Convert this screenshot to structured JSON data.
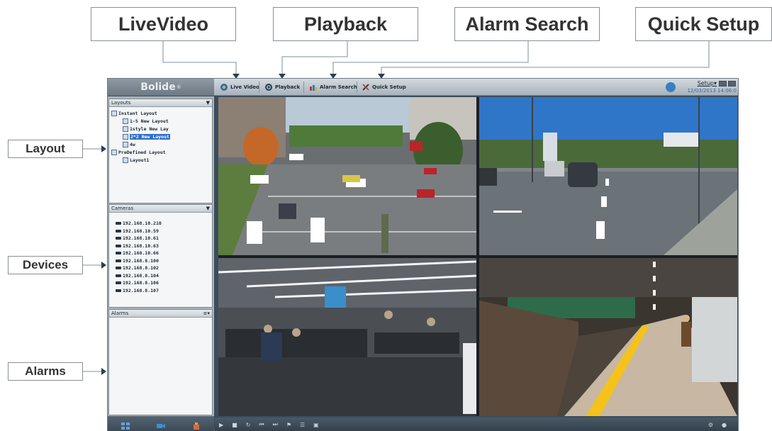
{
  "callouts": {
    "live_video": "LiveVideo",
    "playback": "Playback",
    "alarm_search": "Alarm Search",
    "quick_setup": "Quick Setup",
    "layout": "Layout",
    "devices": "Devices",
    "alarms": "Alarms"
  },
  "app": {
    "brand": "Bolide",
    "brand_mark": "®",
    "nav": [
      "Live Video",
      "Playback",
      "Alarm Search",
      "Quick Setup"
    ],
    "setup": "Setup▾",
    "datetime": "12/03/2013 14:06:0"
  },
  "layouts_panel": {
    "title": "Layouts",
    "items": [
      {
        "label": "Instant Layout",
        "level": 0
      },
      {
        "label": "1-5 New Layout",
        "level": 1
      },
      {
        "label": "1style New Lay",
        "level": 1
      },
      {
        "label": "2*2 New Layout",
        "level": 1,
        "selected": true
      },
      {
        "label": "4w",
        "level": 1
      },
      {
        "label": "PreDefined Layout",
        "level": 0
      },
      {
        "label": "Layout1",
        "level": 1
      }
    ]
  },
  "cameras_panel": {
    "title": "Cameras",
    "items": [
      "192.168.10.210",
      "192.168.10.59",
      "192.168.10.61",
      "192.168.10.63",
      "192.168.10.66",
      "192.168.8.100",
      "192.168.8.102",
      "192.168.8.104",
      "192.168.8.106",
      "192.168.8.107"
    ]
  },
  "alarms_panel": {
    "title": "Alarms"
  },
  "colors": {
    "accent": "#2f6fc9",
    "window_bg": "#3b4d5c",
    "callout_border": "#8a8f96"
  },
  "icons": [
    "live-video-icon",
    "playback-icon",
    "alarm-search-icon",
    "quick-setup-icon",
    "network-icon",
    "camera-icon",
    "layout-icon"
  ],
  "tiles": [
    "parking-lot",
    "street-intersection",
    "airport-waiting-area",
    "subway-platform"
  ]
}
